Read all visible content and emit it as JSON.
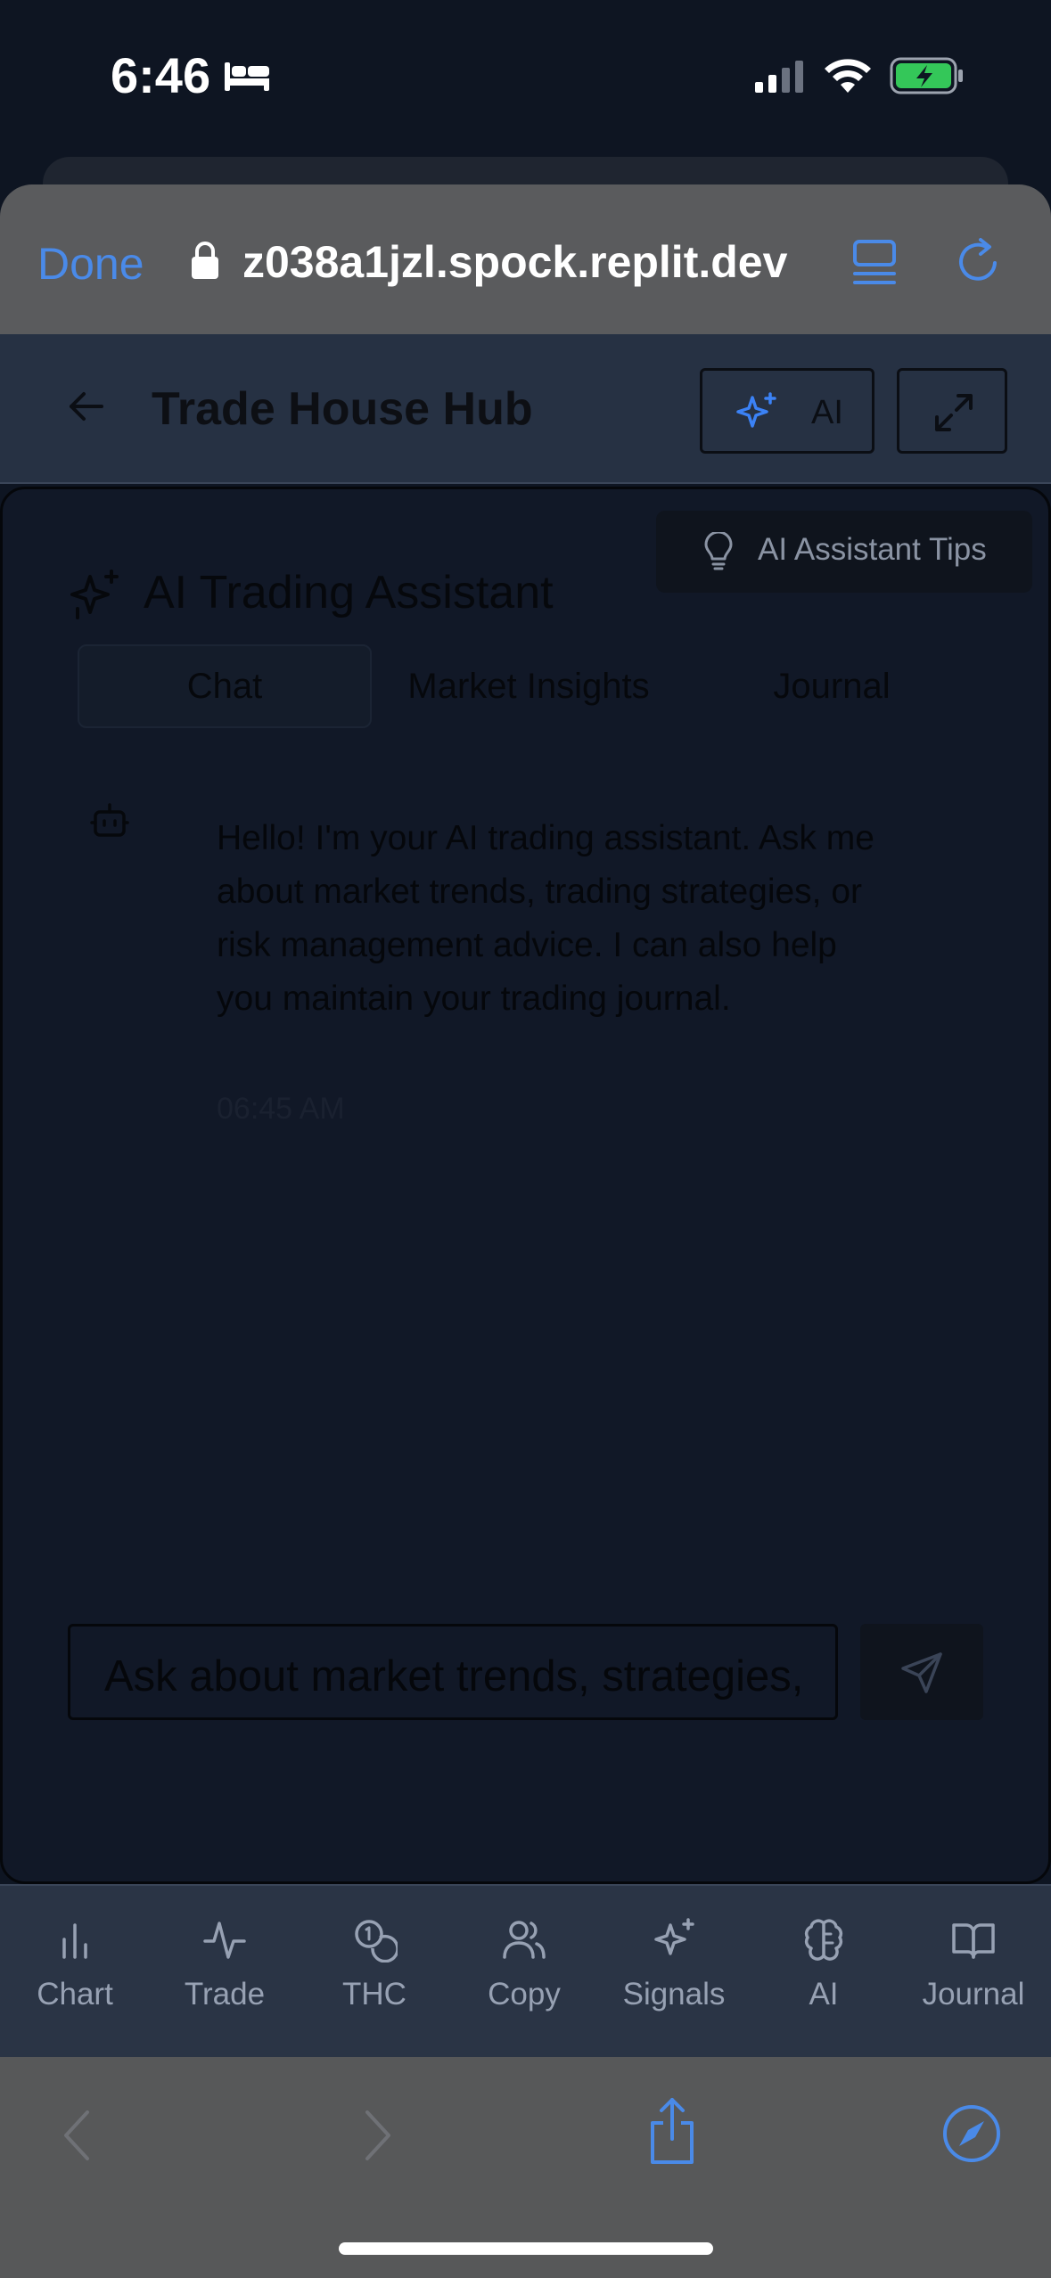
{
  "status_bar": {
    "time": "6:46",
    "icons": [
      "sleep-bed-icon",
      "cellular-signal-icon",
      "wifi-icon",
      "battery-charging-icon"
    ]
  },
  "browser": {
    "done_label": "Done",
    "url": "z038a1jzl.spock.replit.dev",
    "toolbar_icons": [
      "lock-icon",
      "reader-icon",
      "reload-icon"
    ],
    "bottom_icons": [
      "back-icon",
      "forward-icon",
      "share-icon",
      "compass-icon"
    ]
  },
  "app_header": {
    "title": "Trade House Hub",
    "ai_button_label": "AI",
    "accent_color": "#3b82f6"
  },
  "assistant": {
    "tips_label": "AI Assistant Tips",
    "title": "AI Trading Assistant",
    "tabs": [
      {
        "label": "Chat",
        "active": true
      },
      {
        "label": "Market Insights",
        "active": false
      },
      {
        "label": "Journal",
        "active": false
      }
    ],
    "messages": [
      {
        "sender": "assistant",
        "text": "Hello! I'm your AI trading assistant. Ask me about market trends, trading strategies, or risk management advice. I can also help you maintain your trading journal.",
        "time": "06:45 AM"
      }
    ],
    "input_text": "Ask about market trends, strategies,"
  },
  "bottom_nav": {
    "items": [
      {
        "label": "Chart",
        "icon": "bar-chart-icon"
      },
      {
        "label": "Trade",
        "icon": "activity-icon"
      },
      {
        "label": "THC",
        "icon": "coins-icon"
      },
      {
        "label": "Copy",
        "icon": "users-icon"
      },
      {
        "label": "Signals",
        "icon": "sparkles-icon"
      },
      {
        "label": "AI",
        "icon": "brain-icon"
      },
      {
        "label": "Journal",
        "icon": "book-icon"
      }
    ]
  }
}
